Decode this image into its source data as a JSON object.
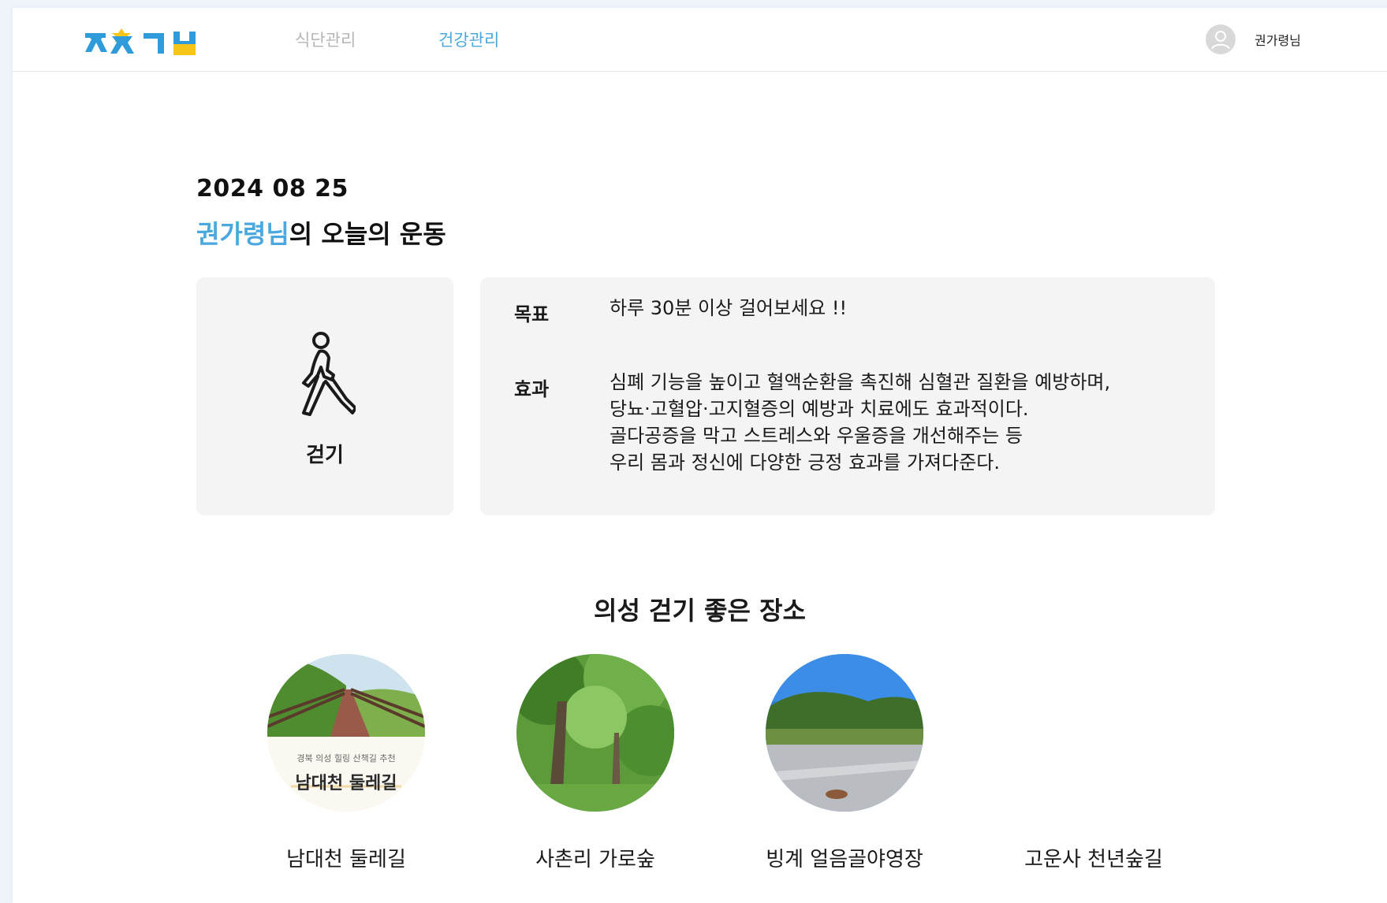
{
  "header": {
    "logo_name": "app-logo",
    "nav": [
      {
        "label": "식단관리",
        "active": false
      },
      {
        "label": "건강관리",
        "active": true
      }
    ],
    "user_name": "권가령님"
  },
  "main": {
    "date": "2024 08 25",
    "title_highlight": "권가령님",
    "title_rest": "의 오늘의 운동",
    "exercise": {
      "name": "걷기",
      "icon": "walking-person-icon"
    },
    "info": {
      "goal_label": "목표",
      "goal_text": "하루 30분 이상 걸어보세요 !!",
      "effect_label": "효과",
      "effect_lines": [
        "심폐 기능을 높이고 혈액순환을 촉진해 심혈관 질환을 예방하며,",
        "당뇨·고혈압·고지혈증의 예방과 치료에도 효과적이다.",
        "골다공증을 막고 스트레스와 우울증을 개선해주는 등",
        "우리 몸과 정신에 다양한 긍정 효과를 가져다준다."
      ]
    },
    "places_title": "의성 걷기 좋은 장소",
    "places": [
      {
        "name": "남대천 둘레길",
        "photo_caption_small": "경북 의성 힐링 산책길 추천",
        "photo_caption_big": "남대천 둘레길"
      },
      {
        "name": "사촌리 가로숲"
      },
      {
        "name": "빙계 얼음골야영장"
      },
      {
        "name": "고운사 천년숲길"
      }
    ]
  },
  "colors": {
    "accent": "#4aa8de",
    "card_bg": "#f4f4f4",
    "nav_inactive": "#b5b5b5"
  }
}
